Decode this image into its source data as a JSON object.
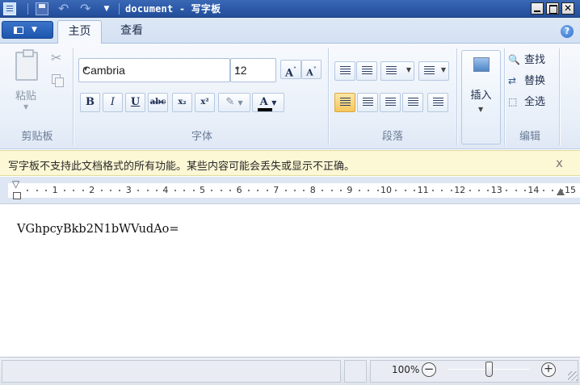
{
  "window": {
    "title": "document - 写字板"
  },
  "tabs": {
    "home": "主页",
    "view": "查看"
  },
  "help": {
    "glyph": "?"
  },
  "clipboard": {
    "paste_label": "粘贴",
    "group_label": "剪贴板"
  },
  "font": {
    "name": "Cambria",
    "size": "12",
    "group_label": "字体",
    "bold": "B",
    "italic": "I",
    "underline": "U",
    "strike": "abc",
    "subscript": "x₂",
    "superscript": "x²",
    "grow": "A",
    "shrink": "A",
    "color_glyph": "A"
  },
  "paragraph": {
    "group_label": "段落"
  },
  "insert": {
    "label": "插入"
  },
  "editing": {
    "find": "查找",
    "replace": "替换",
    "select_all": "全选",
    "group_label": "编辑"
  },
  "warning": {
    "text": "写字板不支持此文档格式的所有功能。某些内容可能会丢失或显示不正确。",
    "close": "x"
  },
  "ruler": {
    "labels": [
      "1",
      "2",
      "3",
      "4",
      "5",
      "6",
      "7",
      "8",
      "9",
      "10",
      "11",
      "12",
      "13",
      "14",
      "15"
    ]
  },
  "document": {
    "text": "VGhpcyBkb2N1bWVudAo="
  },
  "status": {
    "zoom": "100%"
  },
  "colors": {
    "titlebar": "#2a58a6",
    "accent": "#1c56ad",
    "warning_bg": "#fcf7d4",
    "selected_align": "#f5c65c"
  }
}
